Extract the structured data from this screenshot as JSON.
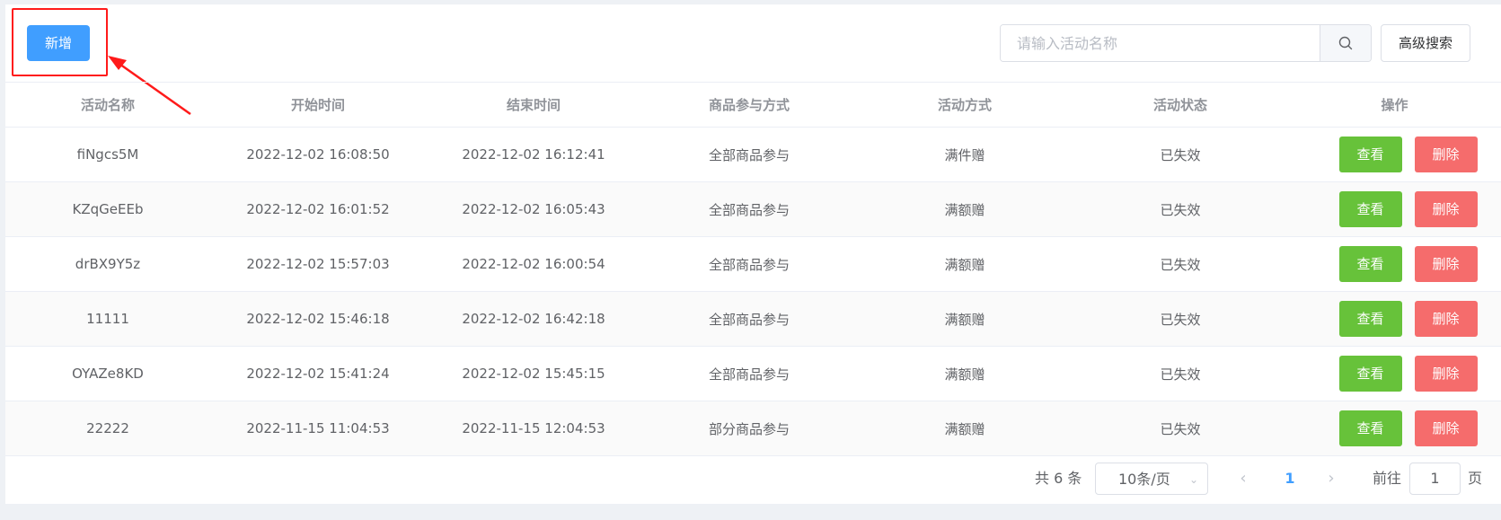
{
  "toolbar": {
    "add_label": "新增",
    "search_placeholder": "请输入活动名称",
    "advanced_label": "高级搜索"
  },
  "table": {
    "headers": [
      "活动名称",
      "开始时间",
      "结束时间",
      "商品参与方式",
      "活动方式",
      "活动状态",
      "操作"
    ],
    "rows": [
      {
        "name": "fiNgcs5M",
        "start": "2022-12-02 16:08:50",
        "end": "2022-12-02 16:12:41",
        "scope": "全部商品参与",
        "mode": "满件赠",
        "status": "已失效"
      },
      {
        "name": "KZqGeEEb",
        "start": "2022-12-02 16:01:52",
        "end": "2022-12-02 16:05:43",
        "scope": "全部商品参与",
        "mode": "满额赠",
        "status": "已失效"
      },
      {
        "name": "drBX9Y5z",
        "start": "2022-12-02 15:57:03",
        "end": "2022-12-02 16:00:54",
        "scope": "全部商品参与",
        "mode": "满额赠",
        "status": "已失效"
      },
      {
        "name": "11111",
        "start": "2022-12-02 15:46:18",
        "end": "2022-12-02 16:42:18",
        "scope": "全部商品参与",
        "mode": "满额赠",
        "status": "已失效"
      },
      {
        "name": "OYAZe8KD",
        "start": "2022-12-02 15:41:24",
        "end": "2022-12-02 15:45:15",
        "scope": "全部商品参与",
        "mode": "满额赠",
        "status": "已失效"
      },
      {
        "name": "22222",
        "start": "2022-11-15 11:04:53",
        "end": "2022-11-15 12:04:53",
        "scope": "部分商品参与",
        "mode": "满额赠",
        "status": "已失效"
      }
    ],
    "view_label": "查看",
    "delete_label": "删除"
  },
  "pagination": {
    "total_label": "共 6 条",
    "page_size": "10条/页",
    "current_page": "1",
    "goto_label": "前往",
    "goto_value": "1",
    "page_unit": "页"
  },
  "colors": {
    "primary": "#409eff",
    "success": "#67c23a",
    "danger": "#f56c6c",
    "annotation": "#ff1a1a"
  }
}
